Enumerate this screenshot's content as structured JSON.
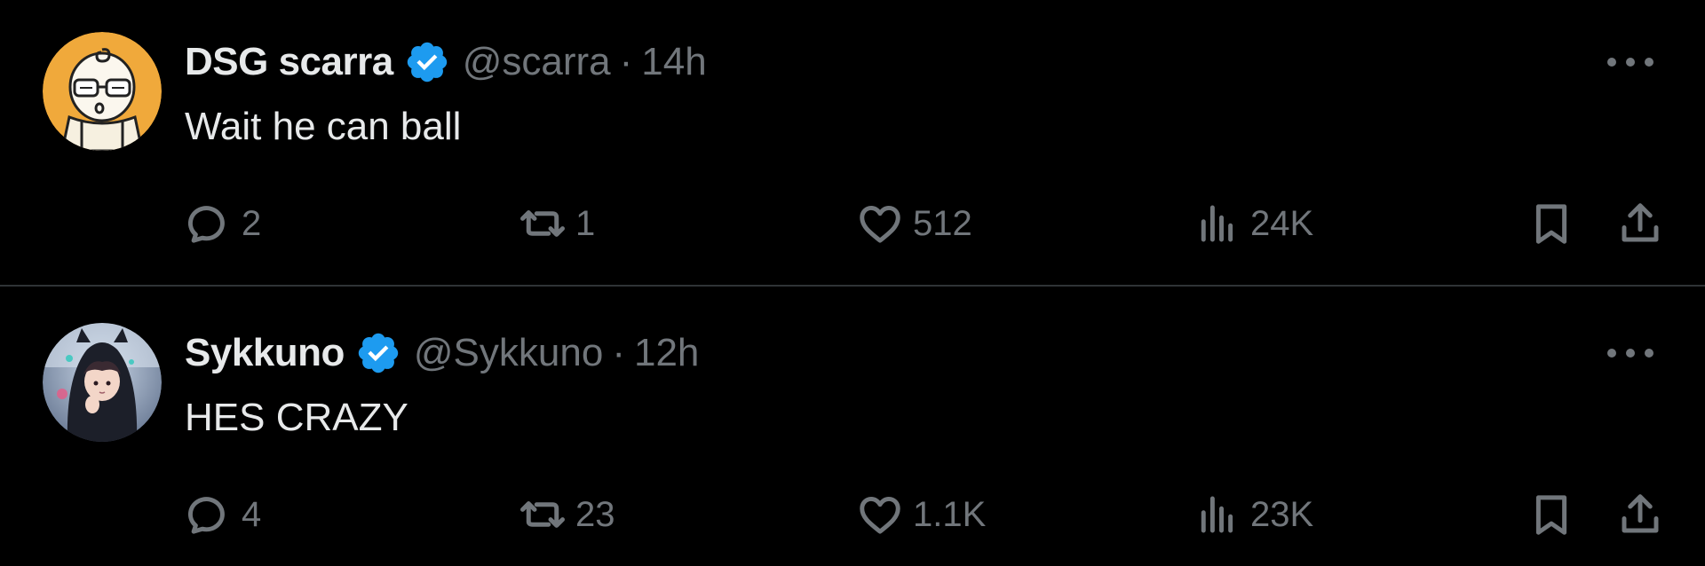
{
  "colors": {
    "background": "#000000",
    "text_primary": "#e7e9ea",
    "text_secondary": "#71767b",
    "divider": "#2f3336",
    "verified": "#1d9bf0",
    "avatar_scarra_bg": "#f0a93b"
  },
  "icons": {
    "reply": "speech-bubble-icon",
    "retweet": "retweet-arrows-icon",
    "like": "heart-icon",
    "views": "bar-chart-icon",
    "bookmark": "bookmark-icon",
    "share": "upload-share-icon",
    "more": "ellipsis-icon",
    "verified": "verified-badge-icon"
  },
  "tweets": [
    {
      "name": "DSG scarra",
      "handle": "@scarra",
      "separator": "·",
      "time": "14h",
      "text": "Wait he can ball",
      "replies": "2",
      "retweets": "1",
      "likes": "512",
      "views": "24K"
    },
    {
      "name": "Sykkuno",
      "handle": "@Sykkuno",
      "separator": "·",
      "time": "12h",
      "text": "HES CRAZY",
      "replies": "4",
      "retweets": "23",
      "likes": "1.1K",
      "views": "23K"
    }
  ]
}
